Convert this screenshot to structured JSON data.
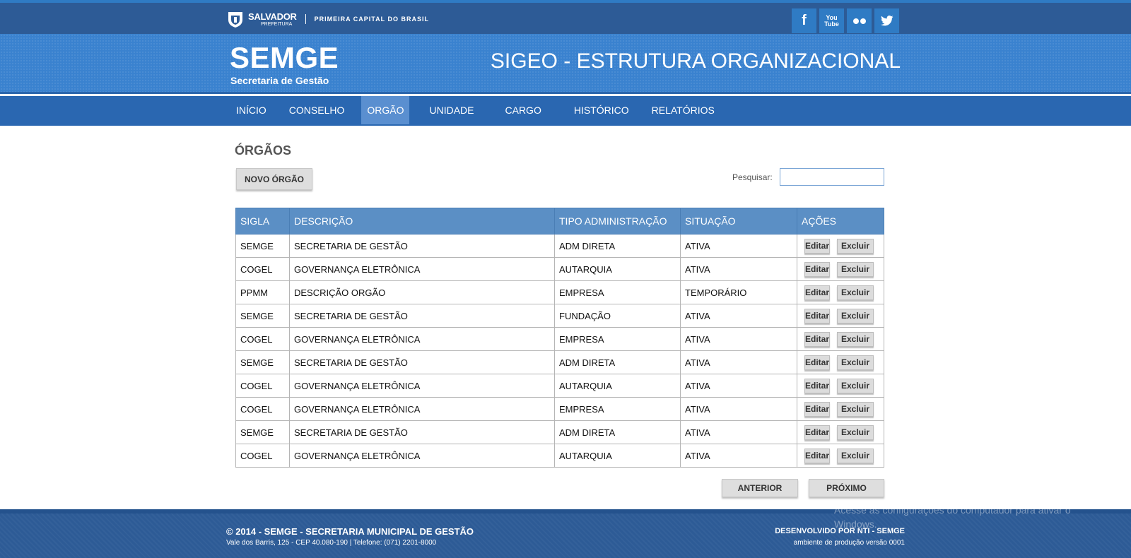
{
  "topbar": {
    "brand_name": "SALVADOR",
    "brand_sub": "PREFEITURA",
    "tagline": "PRIMEIRA CAPITAL DO BRASIL",
    "social": [
      {
        "icon": "facebook-icon",
        "label": "f"
      },
      {
        "icon": "youtube-icon",
        "label": "You Tube"
      },
      {
        "icon": "flickr-icon",
        "label": ""
      },
      {
        "icon": "twitter-icon",
        "label": ""
      }
    ]
  },
  "header": {
    "logo_title": "SEMGE",
    "logo_subtitle": "Secretaria de Gestão",
    "system_title": "SIGEO - ESTRUTURA ORGANIZACIONAL"
  },
  "nav": {
    "items": [
      "INÍCIO",
      "CONSELHO",
      "ORGÃO",
      "UNIDADE",
      "CARGO",
      "HISTÓRICO",
      "RELATÓRIOS"
    ],
    "active": "ORGÃO"
  },
  "main": {
    "title": "ÓRGÃOS",
    "new_button": "NOVO ÓRGÃO",
    "search_label": "Pesquisar:",
    "search_value": "",
    "table": {
      "headers": [
        "SIGLA",
        "DESCRIÇÃO",
        "TIPO ADMINISTRAÇÃO",
        "SITUAÇÃO",
        "AÇÕES"
      ],
      "edit_label": "Editar",
      "delete_label": "Excluir",
      "rows": [
        [
          "SEMGE",
          "SECRETARIA DE GESTÃO",
          "ADM DIRETA",
          "ATIVA"
        ],
        [
          "COGEL",
          "GOVERNANÇA ELETRÔNICA",
          "AUTARQUIA",
          "ATIVA"
        ],
        [
          "PPMM",
          "DESCRIÇÃO ORGÃO",
          "EMPRESA",
          "TEMPORÁRIO"
        ],
        [
          "SEMGE",
          "SECRETARIA DE GESTÃO",
          "FUNDAÇÃO",
          "ATIVA"
        ],
        [
          "COGEL",
          "GOVERNANÇA ELETRÔNICA",
          "EMPRESA",
          "ATIVA"
        ],
        [
          "SEMGE",
          "SECRETARIA DE GESTÃO",
          "ADM DIRETA",
          "ATIVA"
        ],
        [
          "COGEL",
          "GOVERNANÇA ELETRÔNICA",
          "AUTARQUIA",
          "ATIVA"
        ],
        [
          "COGEL",
          "GOVERNANÇA ELETRÔNICA",
          "EMPRESA",
          "ATIVA"
        ],
        [
          "SEMGE",
          "SECRETARIA DE GESTÃO",
          "ADM DIRETA",
          "ATIVA"
        ],
        [
          "COGEL",
          "GOVERNANÇA ELETRÔNICA",
          "AUTARQUIA",
          "ATIVA"
        ]
      ]
    },
    "prev_button": "ANTERIOR",
    "next_button": "PRÓXIMO"
  },
  "footer": {
    "copyright": "© 2014 - SEMGE - SECRETARIA MUNICIPAL DE GESTÃO",
    "address": "Vale dos Barris, 125 - CEP 40.080-190 | Telefone: (071) 2201-8000",
    "developer": "DESENVOLVIDO POR NTI - SEMGE",
    "version": "ambiente de produção versão 0001"
  },
  "os_watermark": "Acesse as configurações do computador para ativar o Windows."
}
